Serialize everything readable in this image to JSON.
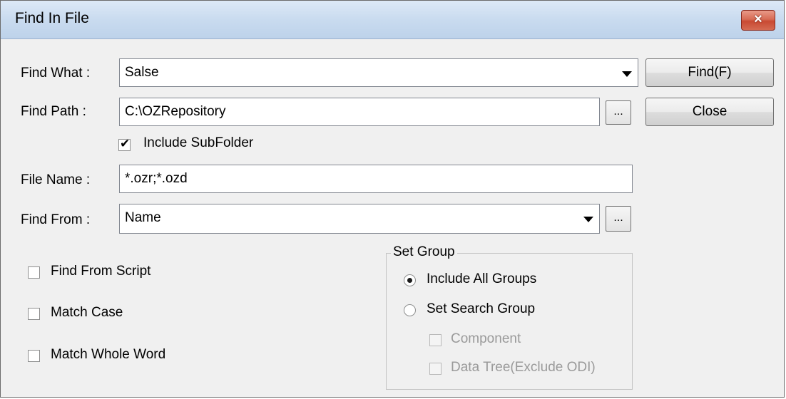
{
  "window": {
    "title": "Find In File",
    "close_icon": "×"
  },
  "find_what": {
    "label": "Find What :",
    "value": "Salse"
  },
  "find_path": {
    "label": "Find Path :",
    "value": "C:\\OZRepository",
    "browse_label": "..."
  },
  "include_subfolder": {
    "label": "Include SubFolder",
    "checked": true
  },
  "file_name": {
    "label": "File Name :",
    "value": "*.ozr;*.ozd"
  },
  "find_from": {
    "label": "Find From :",
    "value": "Name",
    "browse_label": "..."
  },
  "buttons": {
    "find": "Find(F)",
    "close": "Close"
  },
  "options": {
    "find_from_script": "Find From Script",
    "match_case": "Match Case",
    "match_whole_word": "Match Whole Word"
  },
  "set_group": {
    "legend": "Set Group",
    "include_all": "Include All Groups",
    "set_search": "Set Search Group",
    "component": "Component",
    "data_tree": "Data Tree(Exclude ODI)",
    "selected": "Include All Groups"
  }
}
